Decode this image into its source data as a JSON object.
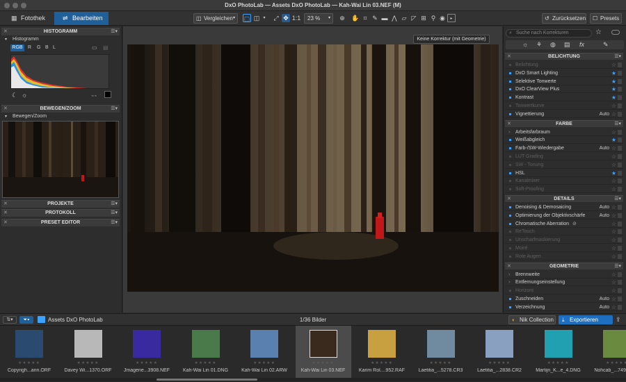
{
  "window": {
    "title": "DxO PhotoLab — Assets DxO PhotoLab — Kah-Wai Lin 03.NEF (M)"
  },
  "tabs": [
    {
      "label": "Fotothek"
    },
    {
      "label": "Bearbeiten"
    }
  ],
  "toolbar": {
    "compare_label": "Vergleichen",
    "ratio_label": "1:1",
    "zoom_value": "23 %",
    "reset_label": "Zurücksetzen",
    "presets_label": "Presets",
    "tooltip": "Keine Korrektur (mit Geometrie)"
  },
  "left_panel": {
    "histogram": {
      "title": "HISTOGRAMM",
      "sub": "Histogramm",
      "channels": [
        "RGB",
        "R",
        "G",
        "B",
        "L"
      ]
    },
    "move_zoom": {
      "title": "BEWEGEN/ZOOM",
      "sub": "Bewegen/Zoom"
    },
    "projects": {
      "title": "PROJEKTE"
    },
    "protocol": {
      "title": "PROTOKOLL"
    },
    "preset_editor": {
      "title": "PRESET EDITOR"
    }
  },
  "right_panel": {
    "search_placeholder": "Suche nach Korrekturen",
    "sections": [
      {
        "title": "BELICHTUNG",
        "items": [
          {
            "label": "Belichtung",
            "dim": true,
            "star": false,
            "value": ""
          },
          {
            "label": "DxO Smart Lighting",
            "dim": false,
            "star": true,
            "value": ""
          },
          {
            "label": "Selektive Tonwerte",
            "dim": false,
            "star": true,
            "value": ""
          },
          {
            "label": "DxO ClearView Plus",
            "dim": false,
            "star": true,
            "value": ""
          },
          {
            "label": "Kontrast",
            "dim": false,
            "star": true,
            "value": ""
          },
          {
            "label": "Tonwertkurve",
            "dim": true,
            "star": false,
            "value": ""
          },
          {
            "label": "Vignettierung",
            "dim": false,
            "star": false,
            "value": "Auto"
          }
        ]
      },
      {
        "title": "FARBE",
        "items": [
          {
            "label": "Arbeitsfarbraum",
            "dim": false,
            "star": false,
            "value": "",
            "arrow": true
          },
          {
            "label": "Weißabgleich",
            "dim": false,
            "star": true,
            "value": ""
          },
          {
            "label": "Farb-/SW-Wiedergabe",
            "dim": false,
            "star": false,
            "value": "Auto"
          },
          {
            "label": "LUT Grading",
            "dim": true,
            "star": false,
            "value": ""
          },
          {
            "label": "SW - Tonung",
            "dim": true,
            "star": false,
            "value": ""
          },
          {
            "label": "HSL",
            "dim": false,
            "star": true,
            "value": ""
          },
          {
            "label": "Kanalmixer",
            "dim": true,
            "star": false,
            "value": ""
          },
          {
            "label": "Soft-Proofing",
            "dim": true,
            "star": false,
            "value": ""
          }
        ]
      },
      {
        "title": "DETAILS",
        "items": [
          {
            "label": "Denoising & Demosaicing",
            "dim": false,
            "star": false,
            "value": "Auto"
          },
          {
            "label": "Optimierung der Objektivschärfe",
            "dim": false,
            "star": false,
            "value": "Auto"
          },
          {
            "label": "Chromatische Aberration",
            "dim": false,
            "star": false,
            "value": "",
            "eye": true
          },
          {
            "label": "ReTouch",
            "dim": true,
            "star": false,
            "value": ""
          },
          {
            "label": "Unscharfmaskierung",
            "dim": true,
            "star": false,
            "value": ""
          },
          {
            "label": "Moiré",
            "dim": true,
            "star": false,
            "value": ""
          },
          {
            "label": "Rote Augen",
            "dim": true,
            "star": false,
            "value": ""
          }
        ]
      },
      {
        "title": "GEOMETRIE",
        "items": [
          {
            "label": "Brennweite",
            "dim": false,
            "star": false,
            "value": "",
            "arrow": true
          },
          {
            "label": "Entfernungseinstellung",
            "dim": false,
            "star": false,
            "value": "",
            "arrow": true
          },
          {
            "label": "Horizont",
            "dim": true,
            "star": false,
            "value": ""
          },
          {
            "label": "Zuschneiden",
            "dim": false,
            "star": false,
            "value": "Auto"
          },
          {
            "label": "Verzeichnung",
            "dim": false,
            "star": false,
            "value": "Auto"
          }
        ]
      }
    ]
  },
  "filmbar": {
    "folder": "Assets DxO PhotoLab",
    "count": "1/36 Bilder",
    "nik_label": "Nik Collection",
    "export_label": "Exportieren"
  },
  "thumbnails": [
    {
      "caption": "Copyrigh...ann.ORF",
      "color": "#2a4a70"
    },
    {
      "caption": "Davey Wi...1370.ORF",
      "color": "#b8b8b8"
    },
    {
      "caption": "Jmagerie...3908.NEF",
      "color": "#3a2aa0"
    },
    {
      "caption": "Kah-Wai Lin 01.DNG",
      "color": "#4a7a4a"
    },
    {
      "caption": "Kah-Wai Lin 02.ARW",
      "color": "#5a80b0"
    },
    {
      "caption": "Kah-Wai Lin 03.NEF",
      "color": "#3a2a1e"
    },
    {
      "caption": "Karim Rol....952.RAF",
      "color": "#c8a040"
    },
    {
      "caption": "Laetitia_...5278.CR3",
      "color": "#708aa0"
    },
    {
      "caption": "Laetitia_...2838.CR2",
      "color": "#8aa0c0"
    },
    {
      "caption": "Martijn_K...e_4.DNG",
      "color": "#20a0b0"
    },
    {
      "caption": "Nohcab_...7491.NEF",
      "color": "#6a8a40"
    }
  ]
}
